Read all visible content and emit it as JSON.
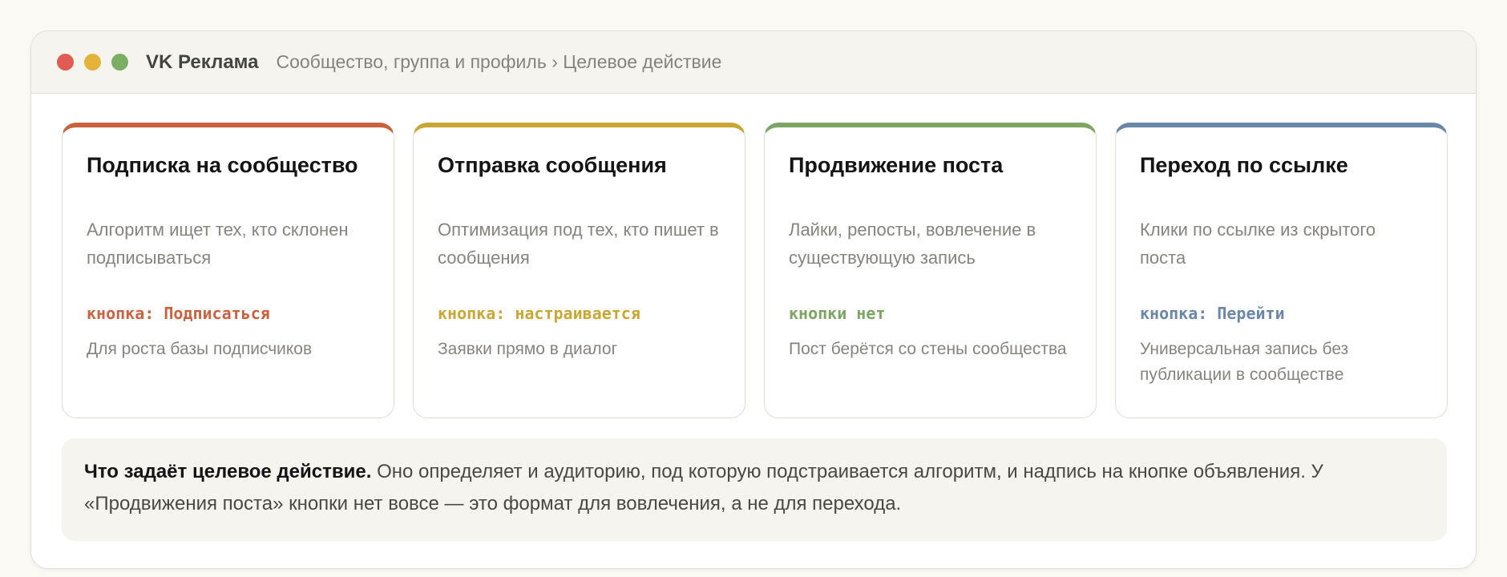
{
  "window": {
    "app_title": "VK Реклама",
    "breadcrumb": "Сообщество, группа и профиль › Целевое действие"
  },
  "cards": [
    {
      "title": "Подписка на сообщество",
      "description": "Алгоритм ищет тех, кто склонен подписываться",
      "button_text": "кнопка: Подписаться",
      "note": "Для роста базы подписчиков",
      "color": "#c9623f"
    },
    {
      "title": "Отправка сообщения",
      "description": "Оптимизация под тех, кто пишет в сообщения",
      "button_text": "кнопка: настраивается",
      "note": "Заявки прямо в диалог",
      "color": "#c9a735"
    },
    {
      "title": "Продвижение поста",
      "description": "Лайки, репосты, вовлечение в существующую запись",
      "button_text": "кнопки нет",
      "note": "Пост берётся со стены сообщества",
      "color": "#7ca563"
    },
    {
      "title": "Переход по ссылке",
      "description": "Клики по ссылке из скрытого поста",
      "button_text": "кнопка: Перейти",
      "note": "Универсальная запись без публикации в сообществе",
      "color": "#6b87a8"
    }
  ],
  "info": {
    "heading": "Что задаёт целевое действие.",
    "text": " Оно определяет и аудиторию, под которую подстраивается алгоритм, и надпись на кнопке объявления. У «Продвижения поста» кнопки нет вовсе — это формат для вовлечения, а не для перехода."
  }
}
